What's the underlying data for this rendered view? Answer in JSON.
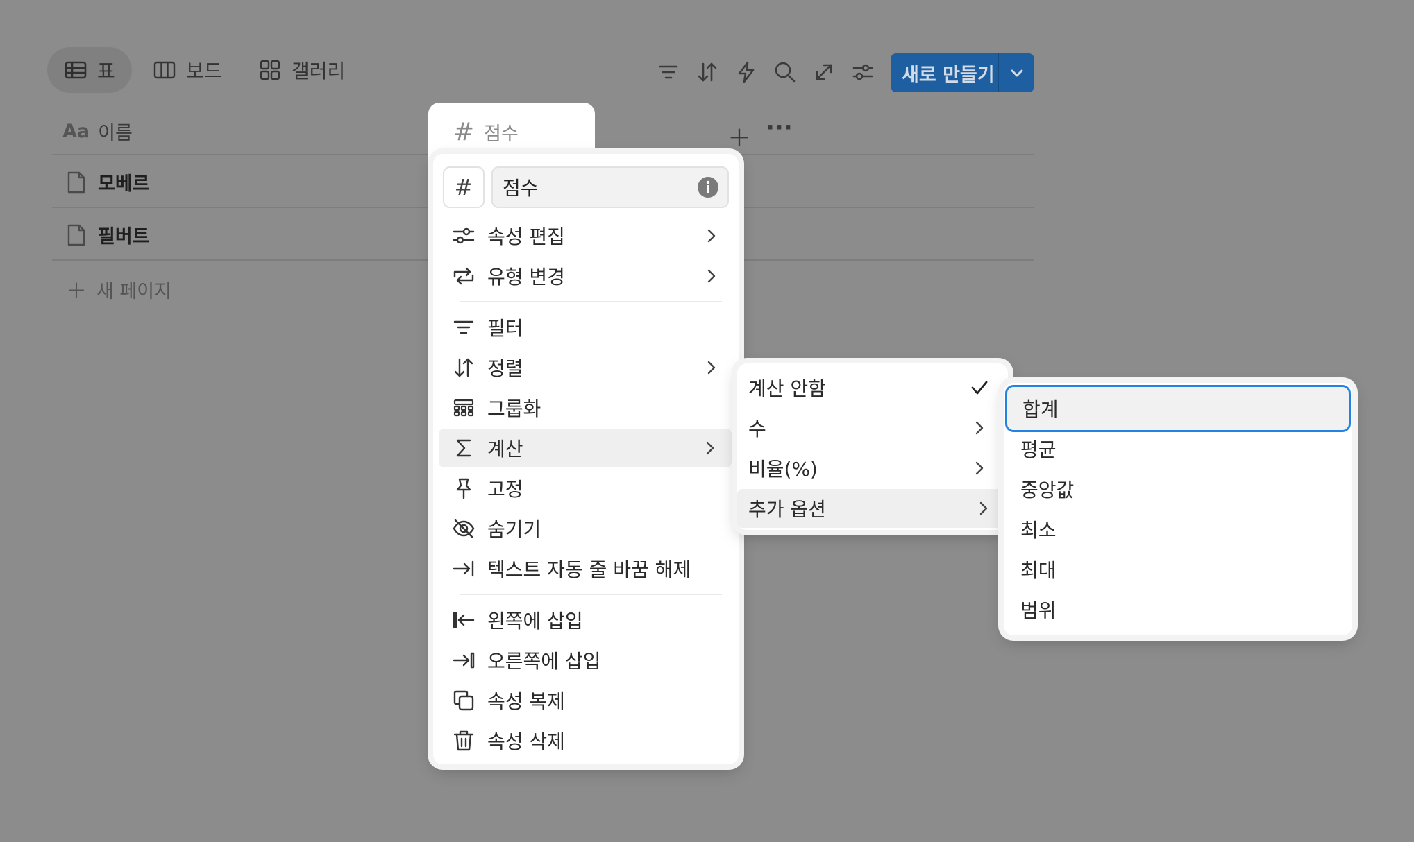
{
  "views": {
    "tabs": [
      {
        "label": "표",
        "icon": "table-icon",
        "active": true
      },
      {
        "label": "보드",
        "icon": "board-icon",
        "active": false
      },
      {
        "label": "갤러리",
        "icon": "gallery-icon",
        "active": false
      }
    ]
  },
  "toolbar": {
    "icons": [
      "filter-icon",
      "sort-icon",
      "automation-bolt-icon",
      "search-icon",
      "expand-icon",
      "settings-sliders-icon"
    ],
    "new_button_label": "새로 만들기"
  },
  "table": {
    "columns": [
      {
        "label": "이름",
        "icon_text": "Aa"
      },
      {
        "label": "점수",
        "icon_text": "#"
      }
    ],
    "rows": [
      "모베르",
      "필버트"
    ],
    "new_page_label": "새 페이지"
  },
  "property_menu": {
    "type_symbol": "#",
    "name_value": "점수",
    "items": [
      {
        "label": "속성 편집",
        "icon": "sliders-icon",
        "submenu": true
      },
      {
        "label": "유형 변경",
        "icon": "change-type-icon",
        "submenu": true
      },
      {
        "label": "필터",
        "icon": "filter-icon",
        "submenu": false
      },
      {
        "label": "정렬",
        "icon": "sort-icon",
        "submenu": true
      },
      {
        "label": "그룹화",
        "icon": "group-icon",
        "submenu": false
      },
      {
        "label": "계산",
        "icon": "sigma-icon",
        "submenu": true,
        "highlighted": true
      },
      {
        "label": "고정",
        "icon": "pin-icon",
        "submenu": false
      },
      {
        "label": "숨기기",
        "icon": "eye-off-icon",
        "submenu": false
      },
      {
        "label": "텍스트 자동 줄 바꿈 해제",
        "icon": "unwrap-icon",
        "submenu": false
      },
      {
        "label": "왼쪽에 삽입",
        "icon": "insert-left-icon",
        "submenu": false
      },
      {
        "label": "오른쪽에 삽입",
        "icon": "insert-right-icon",
        "submenu": false
      },
      {
        "label": "속성 복제",
        "icon": "duplicate-icon",
        "submenu": false
      },
      {
        "label": "속성 삭제",
        "icon": "trash-icon",
        "submenu": false
      }
    ]
  },
  "calc_menu": {
    "items": [
      {
        "label": "계산 안함",
        "checked": true
      },
      {
        "label": "수",
        "submenu": true
      },
      {
        "label": "비율(%)",
        "submenu": true
      },
      {
        "label": "추가 옵션",
        "submenu": true,
        "highlighted": true
      }
    ]
  },
  "more_options_menu": {
    "items": [
      "합계",
      "평균",
      "중앙값",
      "최소",
      "최대",
      "범위"
    ],
    "selected_index": 0
  },
  "colors": {
    "backdrop": "#8c8c8c",
    "accent": "#2383e2",
    "new_button": "#1d5fa0"
  }
}
